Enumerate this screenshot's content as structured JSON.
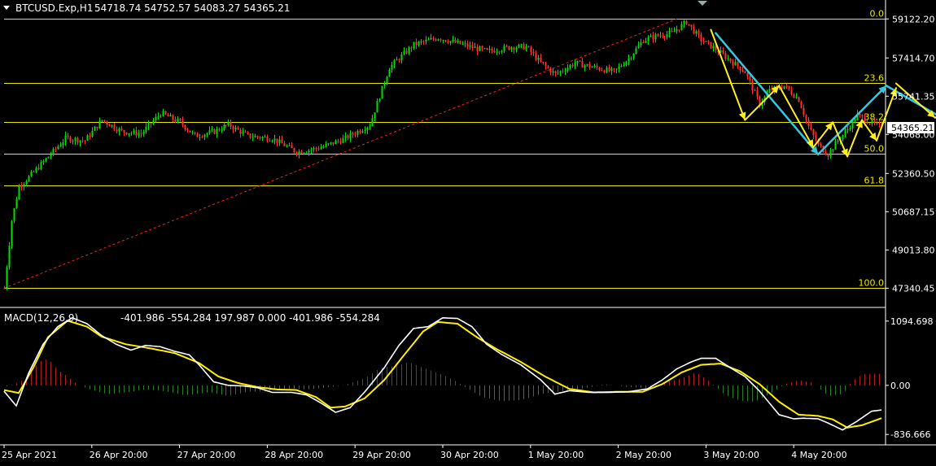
{
  "header": {
    "symbol": "BTCUSD.Exp,H1",
    "ohlc": "54718.74 54752.57 54083.27 54365.21",
    "menu_icon": "triangle-down-icon",
    "corner_icon": "triangle-down-icon"
  },
  "colors": {
    "background": "#000000",
    "axis": "#ffffff",
    "bull_candle": "#00e000",
    "bear_candle": "#ff3030",
    "fib_line": "#e8e800",
    "trendline": "#ff2020",
    "forecast_yellow": "#ffee22",
    "forecast_cyan": "#33c8e0",
    "macd_line": "#ffffff",
    "signal_line": "#ffee00",
    "hist_pos": "#aa2020",
    "hist_neg": "#2a7a2a"
  },
  "chart_data": [
    {
      "type": "candlestick",
      "title": "BTCUSD.Exp,H1",
      "ylim": [
        46500,
        59950
      ],
      "price_ticks": [
        "59122.20",
        "57414.70",
        "55741.35",
        "54068.00",
        "52360.50",
        "50687.15",
        "49013.80",
        "47340.45"
      ],
      "current_price": "54365.21",
      "time_labels": [
        "25 Apr 2021",
        "26 Apr 20:00",
        "27 Apr 20:00",
        "28 Apr 20:00",
        "29 Apr 20:00",
        "30 Apr 20:00",
        "1 May 20:00",
        "2 May 20:00",
        "3 May 20:00",
        "4 May 20:00"
      ],
      "anchors": [
        [
          0,
          47340
        ],
        [
          3,
          50300
        ],
        [
          6,
          51800
        ],
        [
          10,
          52200
        ],
        [
          18,
          53100
        ],
        [
          25,
          53900
        ],
        [
          33,
          53800
        ],
        [
          40,
          54700
        ],
        [
          48,
          54200
        ],
        [
          56,
          54100
        ],
        [
          64,
          55000
        ],
        [
          72,
          54600
        ],
        [
          78,
          54000
        ],
        [
          86,
          54200
        ],
        [
          92,
          54500
        ],
        [
          100,
          54000
        ],
        [
          110,
          53900
        ],
        [
          120,
          53300
        ],
        [
          130,
          53500
        ],
        [
          140,
          53900
        ],
        [
          150,
          54500
        ],
        [
          158,
          57000
        ],
        [
          168,
          58000
        ],
        [
          178,
          58300
        ],
        [
          188,
          58000
        ],
        [
          198,
          57700
        ],
        [
          208,
          57900
        ],
        [
          214,
          57900
        ],
        [
          220,
          57200
        ],
        [
          226,
          56700
        ],
        [
          234,
          57200
        ],
        [
          242,
          57000
        ],
        [
          250,
          56800
        ],
        [
          256,
          57400
        ],
        [
          262,
          58200
        ],
        [
          268,
          58400
        ],
        [
          274,
          58500
        ],
        [
          280,
          59000
        ],
        [
          286,
          58200
        ],
        [
          292,
          57800
        ],
        [
          298,
          57300
        ],
        [
          304,
          56800
        ],
        [
          310,
          55400
        ],
        [
          314,
          56000
        ],
        [
          320,
          56200
        ],
        [
          326,
          55600
        ],
        [
          330,
          54400
        ],
        [
          334,
          53600
        ],
        [
          338,
          53200
        ],
        [
          342,
          53800
        ],
        [
          346,
          54300
        ],
        [
          350,
          54900
        ],
        [
          355,
          54600
        ],
        [
          360,
          54365
        ]
      ],
      "fibonacci": {
        "levels": [
          {
            "label": "0.0",
            "price": 59122.2
          },
          {
            "label": "23.6",
            "price": 56337.3
          },
          {
            "label": "38.2",
            "price": 54618.2
          },
          {
            "label": "50.0",
            "price": 53231.3
          },
          {
            "label": "61.8",
            "price": 51840.5
          },
          {
            "label": "100.0",
            "price": 47340.45
          }
        ]
      },
      "trendline": [
        [
          0,
          47340
        ],
        [
          276,
          59122
        ]
      ],
      "forecast_yellow": [
        [
          [
            290,
            58650
          ],
          [
            304,
            54700
          ],
          [
            318,
            56200
          ],
          [
            332,
            53500
          ],
          [
            340,
            54600
          ],
          [
            346,
            53100
          ],
          [
            352,
            54700
          ],
          [
            358,
            53800
          ],
          [
            366,
            56100
          ]
        ],
        [
          [
            366,
            56300
          ],
          [
            382,
            54800
          ],
          [
            396,
            55800
          ],
          [
            412,
            53600
          ],
          [
            424,
            54800
          ]
        ],
        [
          [
            424,
            54600
          ],
          [
            430,
            52300
          ]
        ]
      ],
      "forecast_cyan": [
        [
          [
            292,
            58500
          ],
          [
            334,
            53200
          ],
          [
            362,
            56200
          ],
          [
            414,
            53000
          ],
          [
            428,
            52100
          ]
        ]
      ]
    },
    {
      "type": "line",
      "title": "MACD(12,26,9)",
      "values_text": "-401.986 -554.284 197.987 0.000 -401.986 -554.284",
      "ylim": [
        -1000,
        1300
      ],
      "ticks": [
        "1094.698",
        "0.00",
        "-836.666"
      ],
      "series": [
        {
          "name": "macd",
          "points": [
            [
              0,
              -100
            ],
            [
              5,
              -350
            ],
            [
              10,
              200
            ],
            [
              16,
              700
            ],
            [
              22,
              1000
            ],
            [
              28,
              1150
            ],
            [
              34,
              1050
            ],
            [
              40,
              850
            ],
            [
              46,
              700
            ],
            [
              52,
              600
            ],
            [
              58,
              680
            ],
            [
              64,
              660
            ],
            [
              70,
              580
            ],
            [
              76,
              520
            ],
            [
              80,
              350
            ],
            [
              86,
              60
            ],
            [
              92,
              0
            ],
            [
              98,
              -10
            ],
            [
              104,
              -40
            ],
            [
              110,
              -120
            ],
            [
              118,
              -120
            ],
            [
              124,
              -160
            ],
            [
              130,
              -300
            ],
            [
              136,
              -460
            ],
            [
              142,
              -380
            ],
            [
              148,
              -110
            ],
            [
              156,
              300
            ],
            [
              162,
              680
            ],
            [
              168,
              970
            ],
            [
              174,
              1000
            ],
            [
              180,
              1150
            ],
            [
              186,
              1140
            ],
            [
              192,
              1000
            ],
            [
              198,
              700
            ],
            [
              204,
              530
            ],
            [
              212,
              350
            ],
            [
              220,
              100
            ],
            [
              226,
              -150
            ],
            [
              232,
              -90
            ],
            [
              240,
              -120
            ],
            [
              248,
              -120
            ],
            [
              256,
              -110
            ],
            [
              264,
              -60
            ],
            [
              270,
              90
            ],
            [
              276,
              280
            ],
            [
              282,
              400
            ],
            [
              286,
              460
            ],
            [
              292,
              460
            ],
            [
              298,
              300
            ],
            [
              304,
              150
            ],
            [
              310,
              -100
            ],
            [
              318,
              -500
            ],
            [
              324,
              -570
            ],
            [
              328,
              -560
            ],
            [
              334,
              -570
            ],
            [
              338,
              -640
            ],
            [
              344,
              -760
            ],
            [
              350,
              -610
            ],
            [
              356,
              -440
            ],
            [
              360,
              -420
            ]
          ]
        },
        {
          "name": "signal",
          "points": [
            [
              0,
              -80
            ],
            [
              6,
              -130
            ],
            [
              12,
              300
            ],
            [
              18,
              820
            ],
            [
              26,
              1100
            ],
            [
              34,
              1000
            ],
            [
              40,
              830
            ],
            [
              50,
              700
            ],
            [
              60,
              630
            ],
            [
              70,
              550
            ],
            [
              80,
              380
            ],
            [
              88,
              150
            ],
            [
              96,
              40
            ],
            [
              104,
              -30
            ],
            [
              112,
              -70
            ],
            [
              120,
              -80
            ],
            [
              128,
              -200
            ],
            [
              134,
              -380
            ],
            [
              140,
              -360
            ],
            [
              148,
              -220
            ],
            [
              156,
              90
            ],
            [
              164,
              510
            ],
            [
              172,
              920
            ],
            [
              178,
              1080
            ],
            [
              186,
              1050
            ],
            [
              194,
              820
            ],
            [
              202,
              620
            ],
            [
              212,
              400
            ],
            [
              222,
              150
            ],
            [
              232,
              -60
            ],
            [
              242,
              -120
            ],
            [
              252,
              -110
            ],
            [
              262,
              -110
            ],
            [
              270,
              20
            ],
            [
              278,
              220
            ],
            [
              286,
              350
            ],
            [
              294,
              370
            ],
            [
              302,
              240
            ],
            [
              310,
              20
            ],
            [
              318,
              -280
            ],
            [
              326,
              -500
            ],
            [
              334,
              -520
            ],
            [
              340,
              -580
            ],
            [
              346,
              -720
            ],
            [
              352,
              -680
            ],
            [
              358,
              -590
            ],
            [
              360,
              -560
            ]
          ]
        },
        {
          "name": "histogram",
          "points": [
            [
              0,
              -30
            ],
            [
              6,
              50
            ],
            [
              10,
              150
            ],
            [
              14,
              400
            ],
            [
              18,
              450
            ],
            [
              22,
              260
            ],
            [
              26,
              150
            ],
            [
              30,
              10
            ],
            [
              36,
              -80
            ],
            [
              42,
              -150
            ],
            [
              50,
              -120
            ],
            [
              58,
              -70
            ],
            [
              66,
              -100
            ],
            [
              74,
              -170
            ],
            [
              84,
              -120
            ],
            [
              92,
              -180
            ],
            [
              100,
              -110
            ],
            [
              108,
              -100
            ],
            [
              116,
              -50
            ],
            [
              124,
              -70
            ],
            [
              132,
              -40
            ],
            [
              140,
              10
            ],
            [
              148,
              120
            ],
            [
              154,
              290
            ],
            [
              160,
              330
            ],
            [
              166,
              390
            ],
            [
              172,
              300
            ],
            [
              178,
              210
            ],
            [
              184,
              100
            ],
            [
              190,
              -50
            ],
            [
              196,
              -200
            ],
            [
              204,
              -270
            ],
            [
              212,
              -250
            ],
            [
              220,
              -150
            ],
            [
              228,
              -100
            ],
            [
              236,
              -70
            ],
            [
              246,
              20
            ],
            [
              256,
              -30
            ],
            [
              266,
              -50
            ],
            [
              272,
              60
            ],
            [
              278,
              120
            ],
            [
              284,
              220
            ],
            [
              290,
              50
            ],
            [
              296,
              -170
            ],
            [
              302,
              -260
            ],
            [
              308,
              -280
            ],
            [
              314,
              -150
            ],
            [
              320,
              10
            ],
            [
              326,
              90
            ],
            [
              332,
              40
            ],
            [
              338,
              -180
            ],
            [
              344,
              -150
            ],
            [
              348,
              80
            ],
            [
              352,
              190
            ],
            [
              356,
              200
            ],
            [
              360,
              198
            ]
          ]
        }
      ]
    }
  ]
}
